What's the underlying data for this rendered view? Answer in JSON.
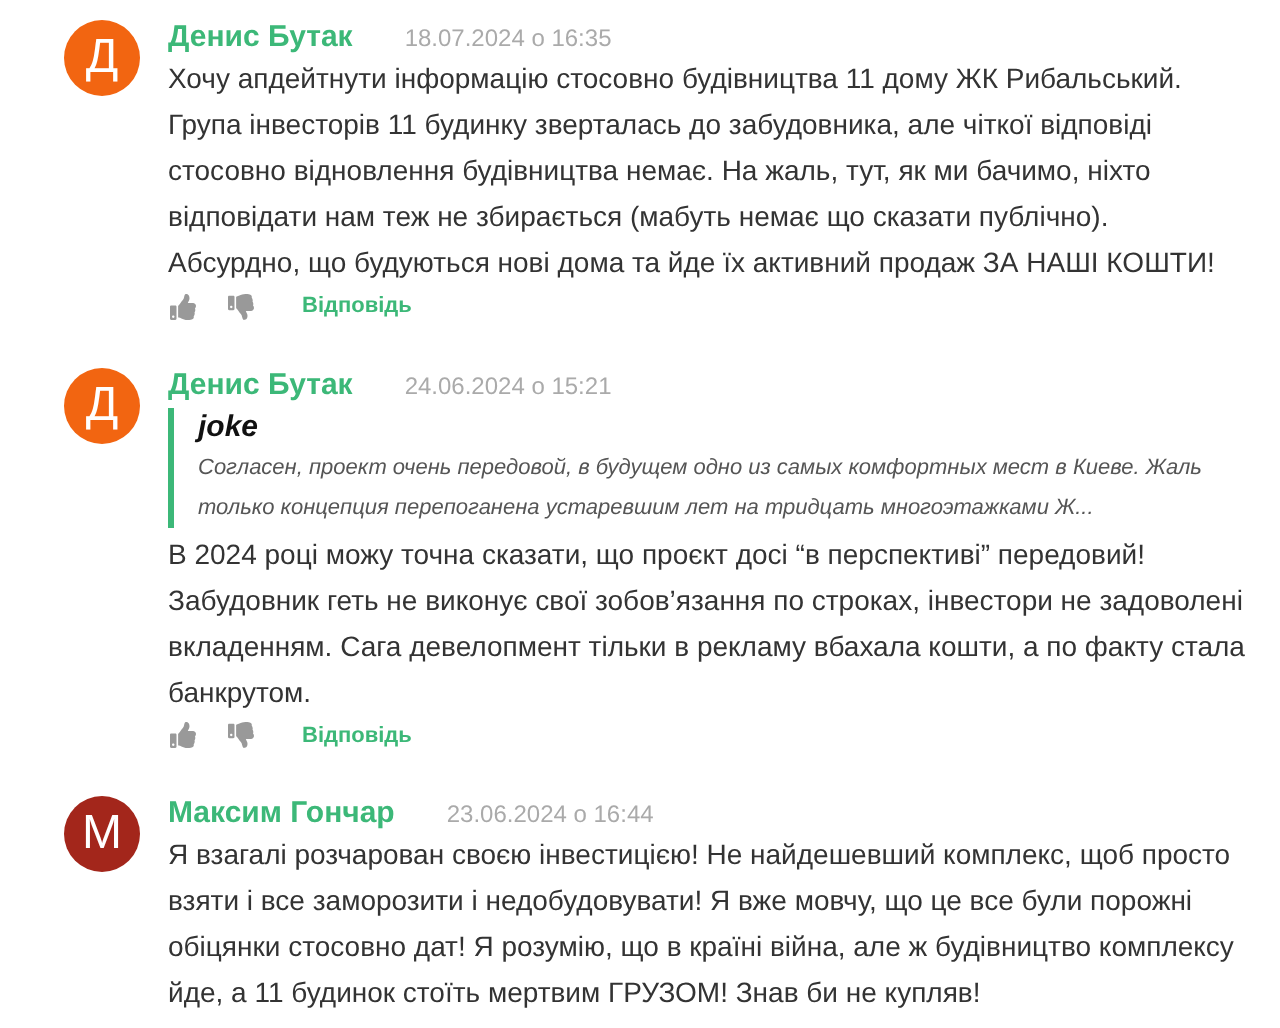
{
  "comments": [
    {
      "author": "Денис Бутак",
      "date": "18.07.2024 о 16:35",
      "avatar": {
        "letter": "Д",
        "color": "#f26511"
      },
      "lines": [
        "Хочу апдейтнути інформацію стосовно будівництва 11 дому ЖК Рибальський.",
        "Група інвесторів 11 будинку зверталась до забудовника, але чіткої відповіді",
        "стосовно відновлення будівництва немає. На жаль, тут, як ми бачимо, ніхто",
        "відповідати нам теж не збирається (мабуть немає що сказати публічно).",
        "Абсурдно, що будуються нові дома та йде їх активний продаж ЗА НАШІ КОШТИ!"
      ],
      "reply_label": "Відповідь"
    },
    {
      "author": "Денис Бутак",
      "date": "24.06.2024 о 15:21",
      "avatar": {
        "letter": "Д",
        "color": "#f26511"
      },
      "quote": {
        "author": "joke",
        "lines": [
          "Согласен, проект очень передовой, в будущем одно из самых комфортных мест в Киеве. Жаль",
          "только концепция перепоганена устаревшим лет на тридцать многоэтажками Ж..."
        ]
      },
      "lines": [
        "В 2024 році можу точна сказати, що проєкт досі “в перспективі” передовий!",
        "Забудовник геть не виконує свої зобов’язання по строках, інвестори не задоволені",
        "вкладенням. Сага девелопмент тільки в рекламу вбахала кошти, а по факту стала",
        "банкрутом."
      ],
      "reply_label": "Відповідь"
    },
    {
      "author": "Максим Гончар",
      "date": "23.06.2024 о 16:44",
      "avatar": {
        "letter": "М",
        "color": "#a3261b"
      },
      "lines": [
        "Я взагалі розчарован своєю інвестицією! Не найдешевший комплекс, щоб просто",
        "взяти і все заморозити і недобудовувати! Я вже мовчу, що це все були порожні",
        "обіцянки стосовно дат! Я розумію, що в країні війна, але ж будівництво комплексу",
        "йде, а 11 будинок стоїть мертвим ГРУЗОМ! Знав би не купляв!"
      ]
    }
  ]
}
